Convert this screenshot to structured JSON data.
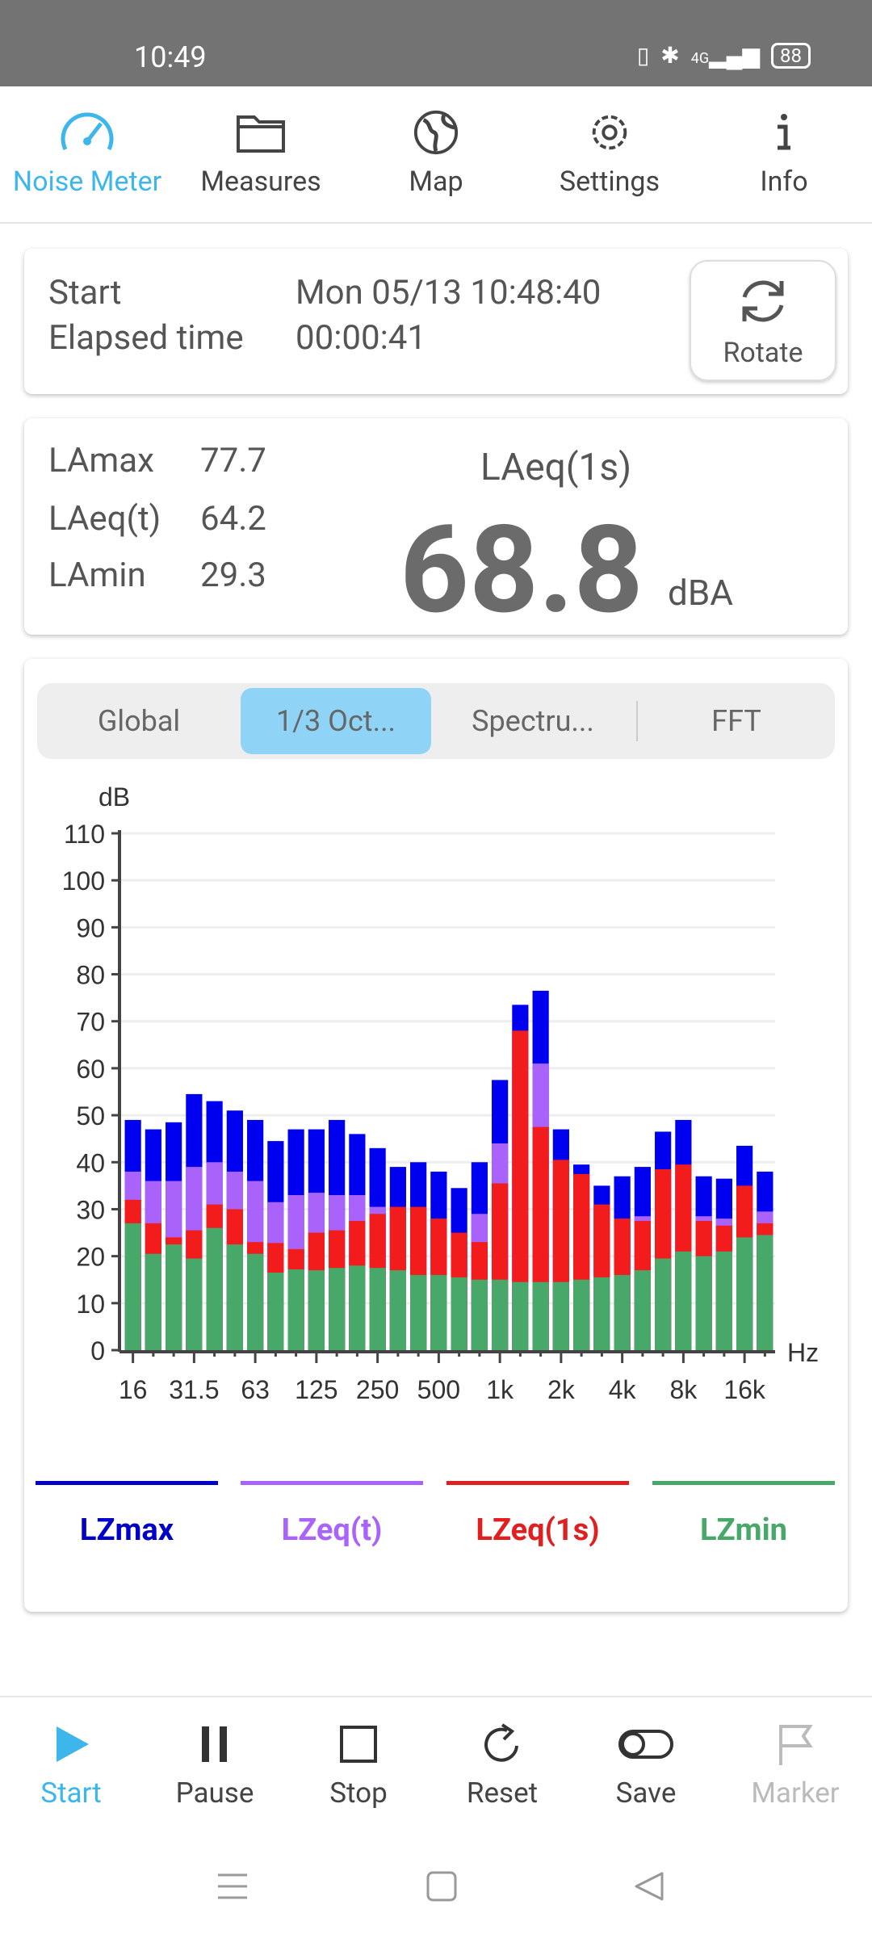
{
  "status_bar": {
    "time": "10:49",
    "network": "4G",
    "battery": "88"
  },
  "top_nav": {
    "items": [
      {
        "label": "Noise Meter",
        "icon": "gauge-icon",
        "active": true
      },
      {
        "label": "Measures",
        "icon": "folder-icon"
      },
      {
        "label": "Map",
        "icon": "globe-icon"
      },
      {
        "label": "Settings",
        "icon": "gear-icon"
      },
      {
        "label": "Info",
        "icon": "info-icon"
      }
    ]
  },
  "session": {
    "start_label": "Start",
    "start_value": "Mon 05/13 10:48:40",
    "elapsed_label": "Elapsed time",
    "elapsed_value": "00:00:41",
    "rotate_label": "Rotate"
  },
  "levels": {
    "lamax_label": "LAmax",
    "lamax": "77.7",
    "laeqt_label": "LAeq(t)",
    "laeqt": "64.2",
    "lamin_label": "LAmin",
    "lamin": "29.3",
    "main_label": "LAeq(1s)",
    "main_value": "68.8",
    "unit": "dBA"
  },
  "tabs": [
    {
      "label": "Global"
    },
    {
      "label": "1/3 Oct...",
      "selected": true
    },
    {
      "label": "Spectru..."
    },
    {
      "label": "FFT"
    }
  ],
  "chart_data": {
    "type": "bar",
    "ylabel": "dB",
    "xlabel": "Hz",
    "ylim": [
      0,
      110
    ],
    "yticks": [
      0,
      10,
      20,
      30,
      40,
      50,
      60,
      70,
      80,
      90,
      100,
      110
    ],
    "xtick_labels": [
      "16",
      "31.5",
      "63",
      "125",
      "250",
      "500",
      "1k",
      "2k",
      "4k",
      "8k",
      "16k"
    ],
    "categories": [
      "16",
      "20",
      "25",
      "31.5",
      "40",
      "50",
      "63",
      "80",
      "100",
      "125",
      "160",
      "200",
      "250",
      "315",
      "400",
      "500",
      "630",
      "800",
      "1k",
      "1.25k",
      "1.6k",
      "2k",
      "2.5k",
      "3.15k",
      "4k",
      "5k",
      "6.3k",
      "8k",
      "10k",
      "12.5k",
      "16k",
      "20k"
    ],
    "grid": true,
    "legend": "bottom",
    "series": [
      {
        "name": "LZmax",
        "color": "#0000f0",
        "values": [
          49,
          47,
          48.5,
          54.5,
          53,
          51,
          49,
          44.5,
          47,
          47,
          49,
          46,
          43,
          39,
          40,
          38,
          34.5,
          40,
          57.5,
          73.5,
          76.5,
          47,
          39.5,
          35,
          37,
          39,
          46.5,
          49,
          37,
          36.5,
          43.5,
          38
        ]
      },
      {
        "name": "LZeq(t)",
        "color": "#a963fa",
        "values": [
          38,
          36,
          36,
          39,
          40,
          38,
          36,
          31.5,
          33,
          33.5,
          33,
          33,
          30.5,
          28,
          28,
          26,
          23,
          29,
          44,
          60,
          61,
          38,
          35,
          29,
          26,
          28.5,
          36,
          37,
          28.5,
          28,
          33,
          29.5
        ]
      },
      {
        "name": "LZeq(1s)",
        "color": "#f21c1c",
        "values": [
          32,
          27,
          24,
          25.5,
          31,
          30,
          23,
          22.8,
          21.5,
          25,
          25.5,
          27.5,
          29,
          30.5,
          30.5,
          28,
          25,
          23,
          35.5,
          68,
          47.5,
          40.5,
          37.5,
          31,
          28,
          27.5,
          38.5,
          39.5,
          27.5,
          26.5,
          35,
          27
        ]
      },
      {
        "name": "LZmin",
        "color": "#48a86a",
        "values": [
          27,
          20.5,
          22.5,
          19.5,
          26,
          22.5,
          20.5,
          16.5,
          17.2,
          17,
          17.5,
          18,
          17.5,
          17,
          16,
          16,
          15.5,
          15,
          15,
          14.5,
          14.5,
          14.5,
          15,
          15.5,
          16,
          17,
          19.5,
          21,
          20,
          21,
          24,
          24.5
        ]
      }
    ]
  },
  "toolbar": {
    "items": [
      {
        "label": "Start",
        "icon": "play-icon",
        "active": true
      },
      {
        "label": "Pause",
        "icon": "pause-icon"
      },
      {
        "label": "Stop",
        "icon": "stop-icon"
      },
      {
        "label": "Reset",
        "icon": "reset-icon"
      },
      {
        "label": "Save",
        "icon": "toggle-icon"
      },
      {
        "label": "Marker",
        "icon": "flag-icon",
        "disabled": true
      }
    ]
  },
  "colors": {
    "accent": "#3db6ec",
    "tab_selected": "#8fd4f6"
  }
}
